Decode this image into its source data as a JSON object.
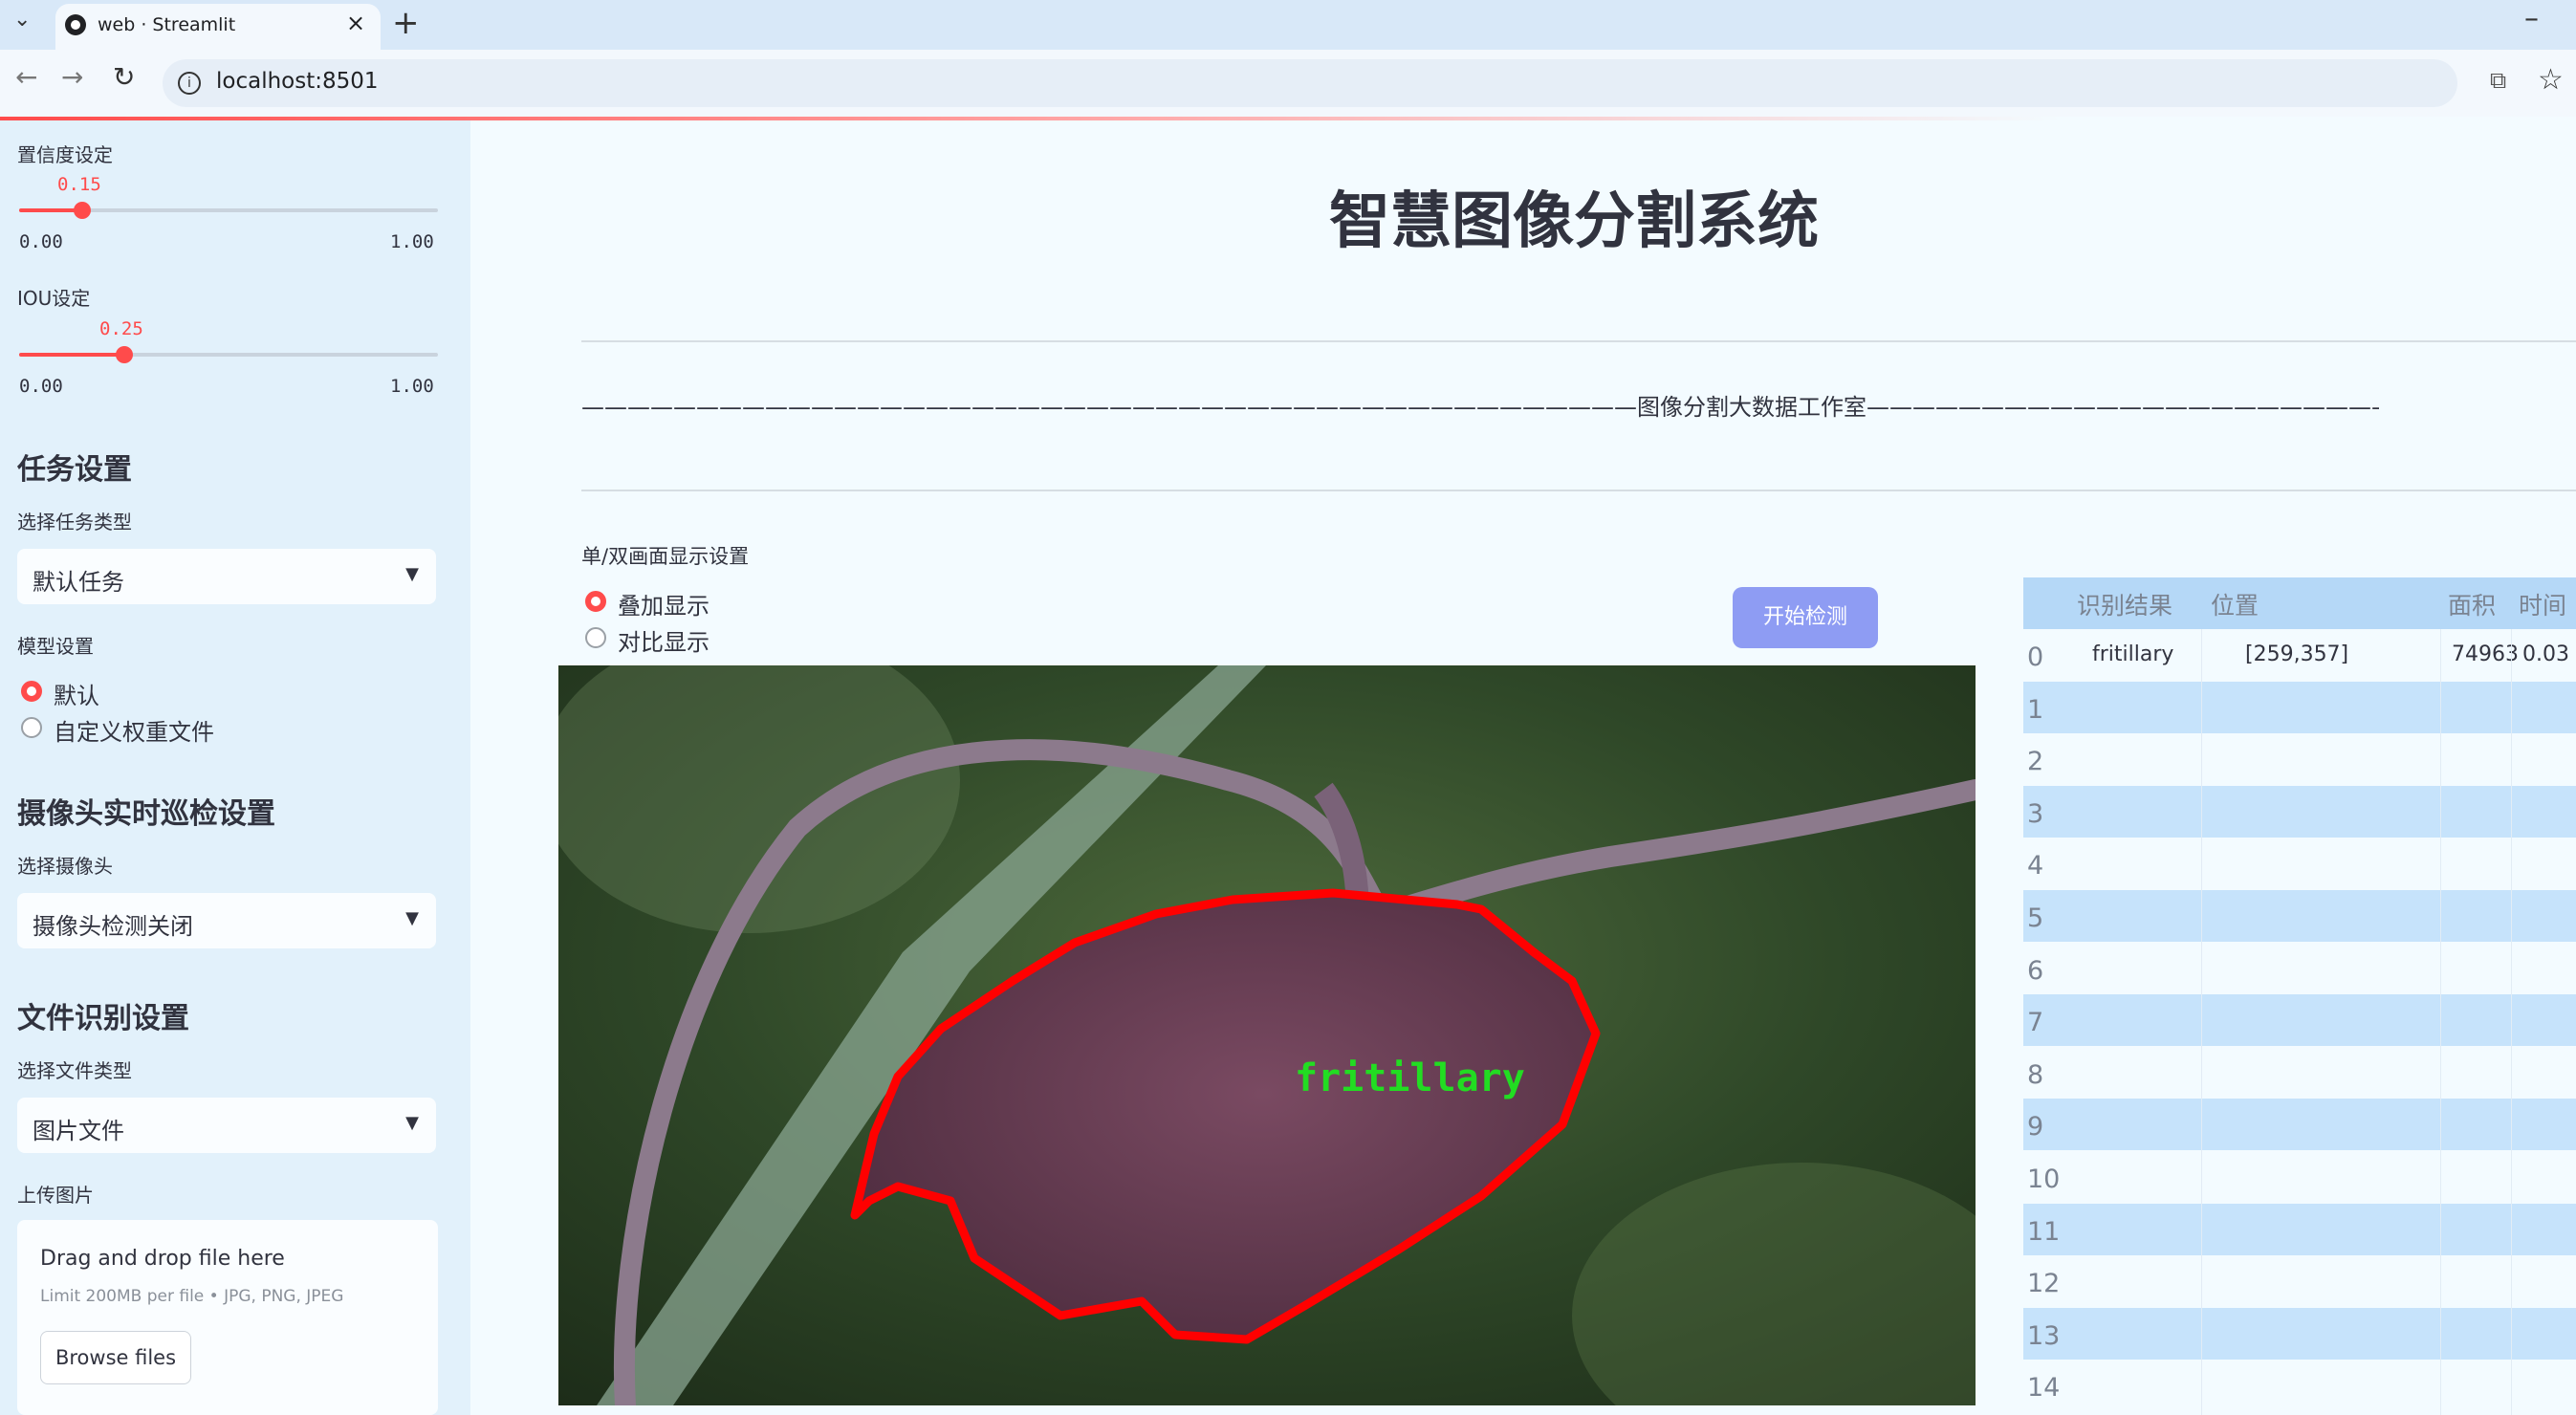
{
  "browser": {
    "tab_title": "web · Streamlit",
    "url": "localhost:8501"
  },
  "sidebar": {
    "confidence": {
      "label": "置信度设定",
      "value": "0.15",
      "min": "0.00",
      "max": "1.00",
      "fraction": 0.15
    },
    "iou": {
      "label": "IOU设定",
      "value": "0.25",
      "min": "0.00",
      "max": "1.00",
      "fraction": 0.25
    },
    "task_section": "任务设置",
    "task_type_label": "选择任务类型",
    "task_type_value": "默认任务",
    "model_label": "模型设置",
    "model_options": [
      "默认",
      "自定义权重文件"
    ],
    "model_selected": 0,
    "camera_section": "摄像头实时巡检设置",
    "camera_label": "选择摄像头",
    "camera_value": "摄像头检测关闭",
    "file_section": "文件识别设置",
    "file_type_label": "选择文件类型",
    "file_type_value": "图片文件",
    "upload_label": "上传图片",
    "uploader": {
      "drop_text": "Drag and drop file here",
      "limit_text": "Limit 200MB per file • JPG, PNG, JPEG",
      "browse_label": "Browse files"
    }
  },
  "main": {
    "title": "智慧图像分割系统",
    "subtitle": "——————————————————————————————————————————————图像分割大数据工作室——————————————————————————————————————————————",
    "display_mode_label": "单/双画面显示设置",
    "display_options": [
      "叠加显示",
      "对比显示"
    ],
    "display_selected": 0,
    "start_button": "开始检测",
    "detection_label": "fritillary",
    "colors": {
      "accent": "#ff4b4b",
      "button": "#8e9cf3",
      "mask": "#ff0000",
      "label_text": "#22dd22"
    }
  },
  "table": {
    "headers": [
      "识别结果",
      "位置",
      "面积",
      "时间"
    ],
    "rows": [
      {
        "index": "0",
        "result": "fritillary",
        "position": "[259,357]",
        "area": "74963",
        "time": "0.03"
      },
      {
        "index": "1"
      },
      {
        "index": "2"
      },
      {
        "index": "3"
      },
      {
        "index": "4"
      },
      {
        "index": "5"
      },
      {
        "index": "6"
      },
      {
        "index": "7"
      },
      {
        "index": "8"
      },
      {
        "index": "9"
      },
      {
        "index": "10"
      },
      {
        "index": "11"
      },
      {
        "index": "12"
      },
      {
        "index": "13"
      },
      {
        "index": "14"
      }
    ]
  }
}
